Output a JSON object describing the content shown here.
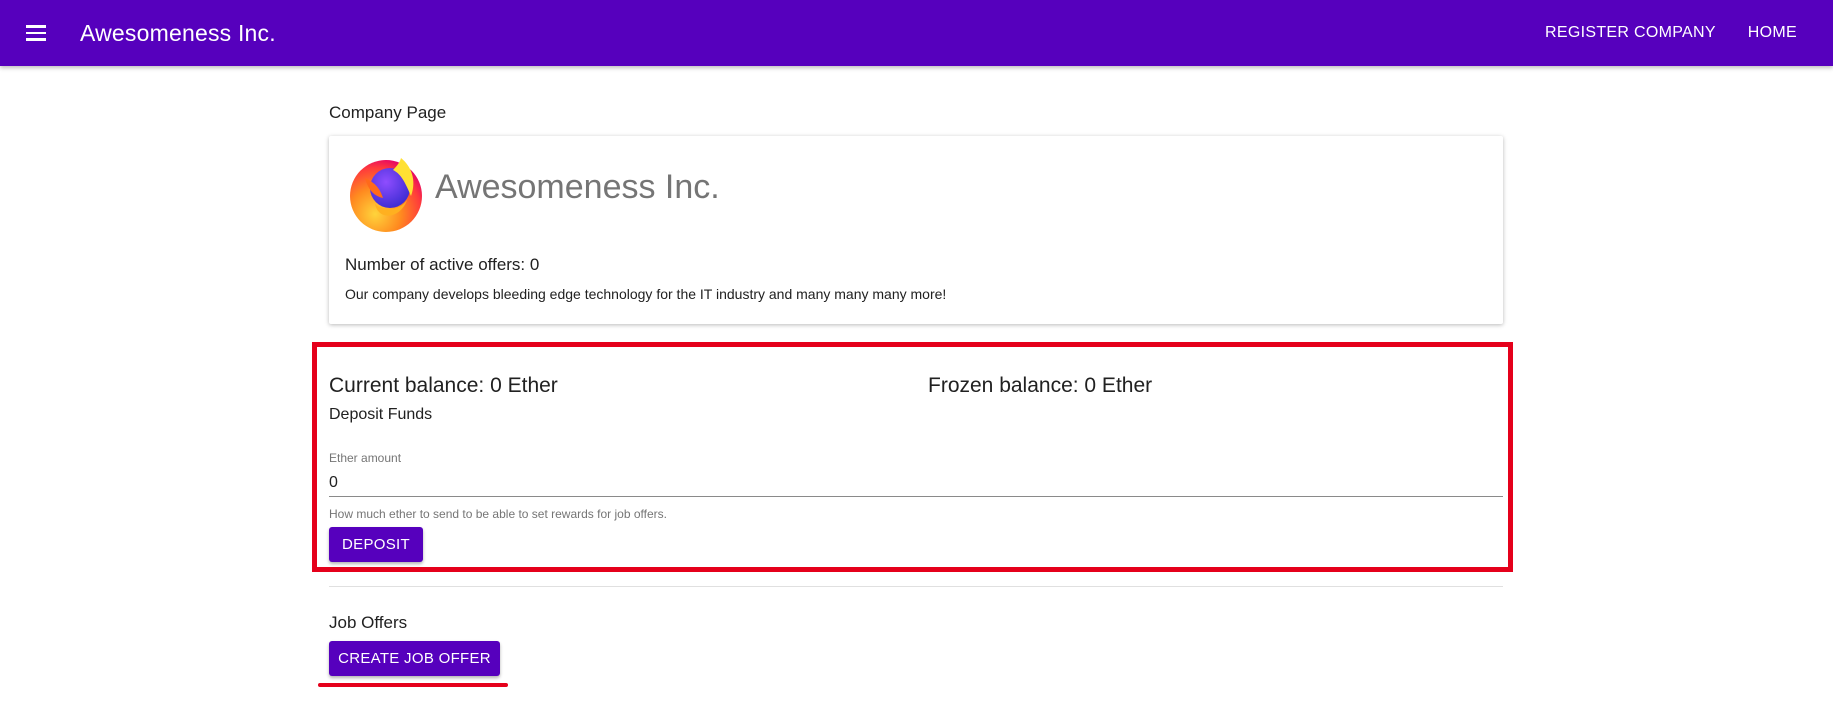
{
  "appbar": {
    "title": "Awesomeness Inc.",
    "menu_icon": "menu-icon",
    "nav": [
      "REGISTER COMPANY",
      "HOME"
    ]
  },
  "page": {
    "section_label": "Company Page"
  },
  "company": {
    "name": "Awesomeness Inc.",
    "logo": "firefox-logo",
    "active_offers": "Number of active offers: 0",
    "description": "Our company develops bleeding edge technology for the IT industry and many many many more!"
  },
  "balance": {
    "current": "Current balance: 0 Ether",
    "frozen": "Frozen balance: 0 Ether",
    "deposit_title": "Deposit Funds",
    "field_label": "Ether amount",
    "field_value": "0",
    "field_hint": "How much ether to send to be able to set rewards for job offers.",
    "deposit_button": "DEPOSIT"
  },
  "jobs": {
    "title": "Job Offers",
    "create_button": "CREATE JOB OFFER"
  },
  "colors": {
    "primary": "#5600bd",
    "highlight": "#e5001b"
  }
}
